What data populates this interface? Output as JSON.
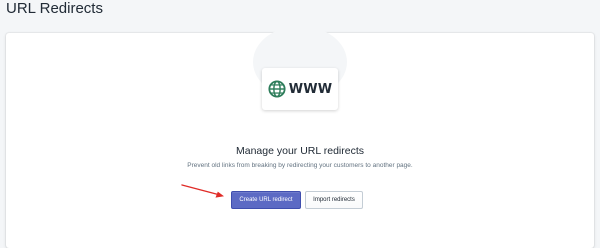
{
  "page": {
    "title": "URL Redirects"
  },
  "empty_state": {
    "illustration_label": "WWW",
    "heading": "Manage your URL redirects",
    "description": "Prevent old links from breaking by redirecting your customers to another page."
  },
  "actions": {
    "create_label": "Create URL redirect",
    "import_label": "Import redirects"
  },
  "icons": {
    "globe": "globe-icon",
    "arrow": "red-pointer-arrow"
  },
  "colors": {
    "primary": "#5c6ac4",
    "globe": "#2e7d5b",
    "arrow": "#e02b27",
    "background": "#f4f6f8"
  }
}
